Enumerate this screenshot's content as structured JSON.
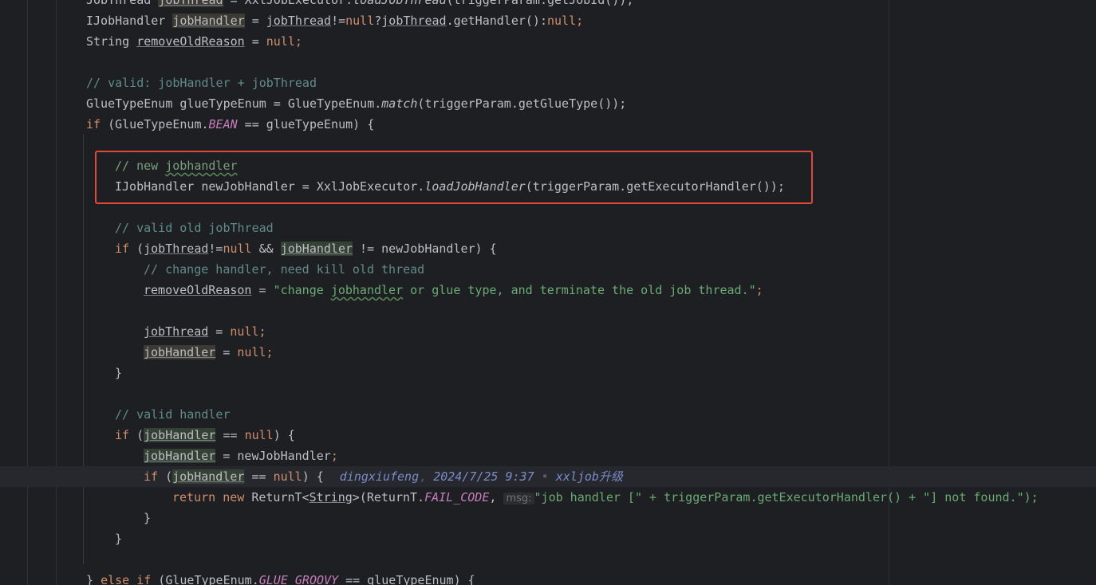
{
  "editor": {
    "lines": [
      {
        "segs": [
          [
            "JobThread ",
            ""
          ],
          [
            "jobThread",
            "var hl2"
          ],
          [
            " = XxlJobExecutor.",
            ""
          ],
          [
            "loadJobThread",
            "it"
          ],
          [
            "(triggerParam.getJobId());",
            ""
          ]
        ]
      },
      {
        "segs": [
          [
            "IJobHandler ",
            ""
          ],
          [
            "jobHandler",
            "var hl2"
          ],
          [
            " = ",
            ""
          ],
          [
            "jobThread",
            "var"
          ],
          [
            "!=",
            ""
          ],
          [
            "null",
            "kw"
          ],
          [
            "?",
            ""
          ],
          [
            "jobThread",
            "var"
          ],
          [
            ".getHandler():",
            ""
          ],
          [
            "null",
            "kw"
          ],
          [
            ";",
            "kw"
          ]
        ]
      },
      {
        "segs": [
          [
            "String ",
            ""
          ],
          [
            "removeOldReason",
            "var"
          ],
          [
            " = ",
            ""
          ],
          [
            "null",
            "kw"
          ],
          [
            ";",
            "kw"
          ]
        ]
      },
      {
        "segs": []
      },
      {
        "segs": [
          [
            "// valid: jobHandler + jobThread",
            "cm2"
          ]
        ]
      },
      {
        "segs": [
          [
            "GlueTypeEnum glueTypeEnum = GlueTypeEnum.",
            ""
          ],
          [
            "match",
            "it"
          ],
          [
            "(triggerParam.getGlueType());",
            ""
          ]
        ]
      },
      {
        "segs": [
          [
            "if",
            "kw"
          ],
          [
            " (GlueTypeEnum.",
            ""
          ],
          [
            "BEAN",
            "fld"
          ],
          [
            " == glueTypeEnum) {",
            ""
          ]
        ]
      },
      {
        "segs": []
      },
      {
        "segs": [
          [
            "// new ",
            "cm"
          ],
          [
            "jobhandler",
            "cm wavy"
          ]
        ]
      },
      {
        "segs": [
          [
            "IJobHandler newJobHandler = XxlJobExecutor.",
            ""
          ],
          [
            "loadJobHandler",
            "it"
          ],
          [
            "(triggerParam.getExecutorHandler());",
            ""
          ]
        ]
      },
      {
        "segs": []
      },
      {
        "segs": [
          [
            "// valid old jobThread",
            "cm2"
          ]
        ]
      },
      {
        "segs": [
          [
            "if",
            "kw"
          ],
          [
            " (",
            ""
          ],
          [
            "jobThread",
            "var"
          ],
          [
            "!=",
            ""
          ],
          [
            "null",
            "kw"
          ],
          [
            " && ",
            ""
          ],
          [
            "jobHandler",
            "var hl"
          ],
          [
            " != newJobHandler) {",
            ""
          ]
        ]
      },
      {
        "segs": [
          [
            "// change handler, need kill old thread",
            "cm2"
          ]
        ]
      },
      {
        "segs": [
          [
            "removeOldReason",
            "var"
          ],
          [
            " = ",
            ""
          ],
          [
            "\"change ",
            "str"
          ],
          [
            "jobhandler",
            "str wavy"
          ],
          [
            " or glue type, and terminate the old job thread.\"",
            "str"
          ],
          [
            ";",
            "kw"
          ]
        ]
      },
      {
        "segs": []
      },
      {
        "segs": [
          [
            "jobThread",
            "var"
          ],
          [
            " = ",
            ""
          ],
          [
            "null",
            "kw"
          ],
          [
            ";",
            "kw"
          ]
        ]
      },
      {
        "segs": [
          [
            "jobHandler",
            "var hl2"
          ],
          [
            " = ",
            ""
          ],
          [
            "null",
            "kw"
          ],
          [
            ";",
            "kw"
          ]
        ]
      },
      {
        "segs": [
          [
            "}",
            ""
          ]
        ]
      },
      {
        "segs": []
      },
      {
        "segs": [
          [
            "// valid handler",
            "cm2"
          ]
        ]
      },
      {
        "segs": [
          [
            "if",
            "kw"
          ],
          [
            " (",
            ""
          ],
          [
            "jobHandler",
            "var hl"
          ],
          [
            " == ",
            ""
          ],
          [
            "null",
            "kw"
          ],
          [
            ") {",
            ""
          ]
        ]
      },
      {
        "segs": [
          [
            "jobHandler",
            "var hl"
          ],
          [
            " = newJobHandler",
            ""
          ],
          [
            ";",
            "kw"
          ]
        ]
      },
      {
        "segs": [
          [
            "if",
            "kw"
          ],
          [
            " (",
            ""
          ],
          [
            "jobHandler",
            "var hl"
          ],
          [
            " == ",
            ""
          ],
          [
            "null",
            "kw"
          ],
          [
            ") {",
            ""
          ]
        ]
      },
      {
        "segs": [
          [
            "return",
            "kw"
          ],
          [
            " ",
            ""
          ],
          [
            "new",
            "kw"
          ],
          [
            " ReturnT<",
            ""
          ],
          [
            "String",
            "var"
          ],
          [
            ">(ReturnT.",
            ""
          ],
          [
            "FAIL_CODE",
            "fld"
          ],
          [
            ", ",
            ""
          ]
        ]
      },
      {
        "segs": [
          [
            "}",
            ""
          ]
        ]
      },
      {
        "segs": [
          [
            "}",
            ""
          ]
        ]
      },
      {
        "segs": []
      },
      {
        "segs": [
          [
            "} ",
            ""
          ],
          [
            "else if",
            "kw"
          ],
          [
            " (GlueTypeEnum.",
            ""
          ],
          [
            "GLUE_GROOVY",
            "fld"
          ],
          [
            " == glueTypeEnum) {",
            ""
          ]
        ]
      }
    ],
    "blame": {
      "author": "dingxiufeng",
      "sep": ",",
      "date": "2024/7/25 9:37",
      "dot": "•",
      "message": "xxljob升级"
    },
    "param_hint": "msg:",
    "return_tail": "\"job handler [\" + triggerParam.getExecutorHandler() + \"] not found.\");"
  }
}
